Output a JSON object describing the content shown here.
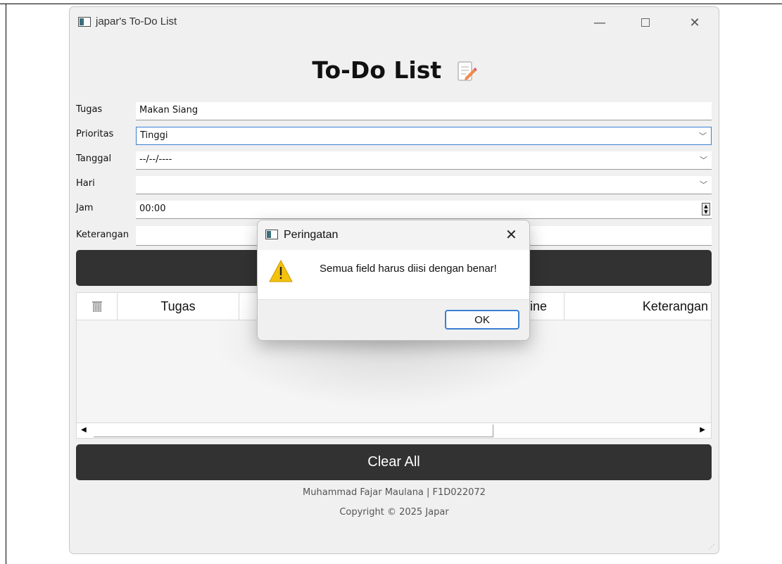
{
  "window": {
    "title": "japar's To-Do List",
    "minimize_glyph": "—",
    "close_glyph": "✕"
  },
  "heading": "To-Do List",
  "form": {
    "tugas_label": "Tugas",
    "tugas_value": "Makan Siang",
    "prioritas_label": "Prioritas",
    "prioritas_value": "Tinggi",
    "tanggal_label": "Tanggal",
    "tanggal_value": "--/--/----",
    "hari_label": "Hari",
    "hari_value": "",
    "jam_label": "Jam",
    "jam_value": "00:00",
    "keterangan_label": "Keterangan",
    "keterangan_value": ""
  },
  "table": {
    "columns": [
      "Tugas",
      "line",
      "Keterangan"
    ]
  },
  "clear_all_label": "Clear All",
  "footer": {
    "author": "Muhammad Fajar Maulana | F1D022072",
    "copyright": "Copyright © 2025 Japar"
  },
  "dialog": {
    "title": "Peringatan",
    "message": "Semua field harus diisi dengan benar!",
    "ok_label": "OK",
    "close_glyph": "✕"
  },
  "icons": {
    "app": "app-window-icon",
    "memo": "memo-pencil-icon",
    "trash": "trash-icon",
    "warning": "warning-icon"
  },
  "colors": {
    "dark_button": "#323232",
    "focus_blue": "#3a7fd2",
    "warning_yellow": "#f4c20d"
  }
}
